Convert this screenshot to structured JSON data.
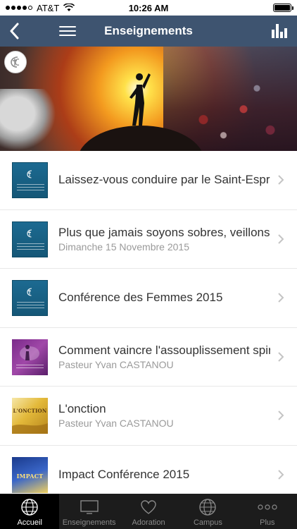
{
  "status_bar": {
    "carrier": "AT&T",
    "time": "10:26 AM",
    "battery_level": 1.0
  },
  "nav_bar": {
    "title": "Enseignements"
  },
  "thumbs": {
    "onction_text": "L'ONCTION",
    "impact_text": "IMPACT"
  },
  "list": {
    "items": [
      {
        "title": "Laissez-vous conduire par le Saint-Esprit",
        "subtitle": "",
        "thumb": "blue"
      },
      {
        "title": "Plus que jamais soyons sobres, veillons",
        "subtitle": "Dimanche 15 Novembre 2015",
        "thumb": "blue"
      },
      {
        "title": "Conférence des Femmes 2015",
        "subtitle": "",
        "thumb": "blue"
      },
      {
        "title": "Comment vaincre l'assouplissement spirituel",
        "subtitle": "Pasteur Yvan CASTANOU",
        "thumb": "purple"
      },
      {
        "title": "L'onction",
        "subtitle": "Pasteur Yvan CASTANOU",
        "thumb": "gold"
      },
      {
        "title": "Impact Conférence 2015",
        "subtitle": "",
        "thumb": "impact"
      }
    ]
  },
  "tab_bar": {
    "tabs": [
      {
        "label": "Accueil",
        "icon": "globe-icon",
        "active": true
      },
      {
        "label": "Enseignements",
        "icon": "monitor-icon",
        "active": false
      },
      {
        "label": "Adoration",
        "icon": "heart-icon",
        "active": false
      },
      {
        "label": "Campus",
        "icon": "globe-icon",
        "active": false
      },
      {
        "label": "Plus",
        "icon": "more-icon",
        "active": false
      }
    ]
  },
  "colors": {
    "nav_bar": "#3e5470",
    "tab_bar": "#1c1c1c",
    "tab_active": "#000000",
    "title_text": "#333333",
    "subtitle_text": "#9a9a9a"
  }
}
